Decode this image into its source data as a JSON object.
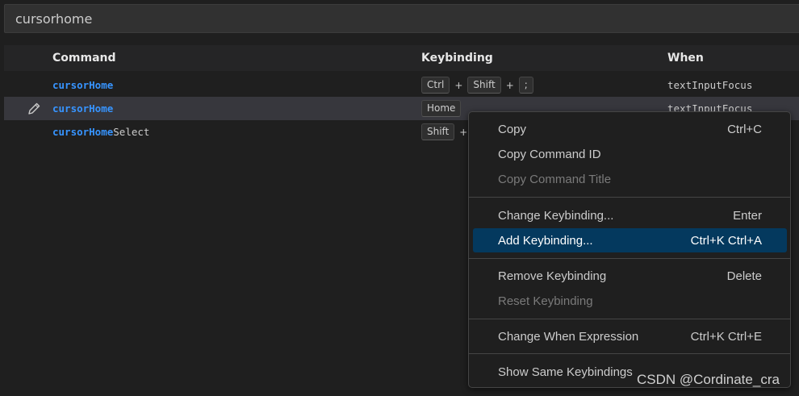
{
  "search": {
    "value": "cursorhome"
  },
  "table": {
    "headers": {
      "command": "Command",
      "keybinding": "Keybinding",
      "when": "When"
    },
    "rows": [
      {
        "cmd_match": "cursorHome",
        "cmd_rest": "",
        "keys": [
          "Ctrl",
          "Shift",
          ";"
        ],
        "when": "textInputFocus"
      },
      {
        "cmd_match": "cursorHome",
        "cmd_rest": "",
        "keys": [
          "Home"
        ],
        "when": "textInputFocus"
      },
      {
        "cmd_match": "cursorHome",
        "cmd_rest": "Select",
        "keys": [
          "Shift"
        ],
        "when": ""
      }
    ],
    "plus": "+"
  },
  "menu": {
    "copy": {
      "label": "Copy",
      "shortcut": "Ctrl+C"
    },
    "copy_command_id": {
      "label": "Copy Command ID"
    },
    "copy_command_title": {
      "label": "Copy Command Title"
    },
    "change_keybinding": {
      "label": "Change Keybinding...",
      "shortcut": "Enter"
    },
    "add_keybinding": {
      "label": "Add Keybinding...",
      "shortcut": "Ctrl+K Ctrl+A"
    },
    "remove_keybinding": {
      "label": "Remove Keybinding",
      "shortcut": "Delete"
    },
    "reset_keybinding": {
      "label": "Reset Keybinding"
    },
    "change_when": {
      "label": "Change When Expression",
      "shortcut": "Ctrl+K Ctrl+E"
    },
    "show_same": {
      "label": "Show Same Keybindings"
    }
  },
  "watermark": "CSDN @Cordinate_cra",
  "colors": {
    "accent": "#3794ff",
    "selection": "#04395e",
    "row_hover": "#37373d",
    "background": "#1f1f1f"
  },
  "icons": {
    "edit": "pencil-icon"
  }
}
